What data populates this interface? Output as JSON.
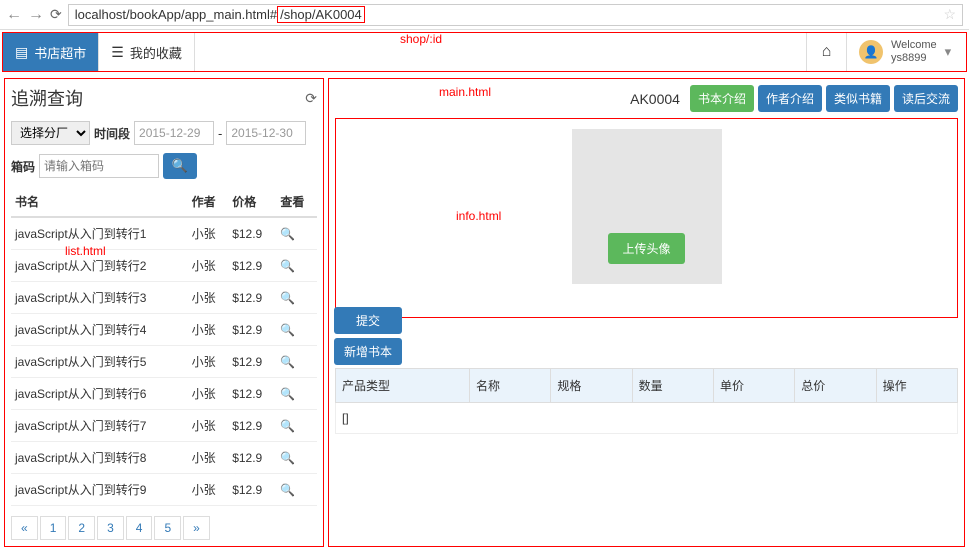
{
  "browser": {
    "url_prefix": "localhost/bookApp/app_main.html#",
    "url_hl": "/shop/AK0004"
  },
  "annotations": {
    "shop_id": "shop/:id",
    "main_html": "main.html",
    "list_html": "list.html",
    "info_html": "info.html"
  },
  "header": {
    "tab1": "书店超市",
    "tab2": "我的收藏",
    "welcome": "Welcome",
    "username": "ys8899"
  },
  "left": {
    "title": "追溯查询",
    "select_label": "选择分厂",
    "period_label": "时间段",
    "date1": "2015-12-29",
    "date2": "2015-12-30",
    "box_label": "箱码",
    "box_ph": "请输入箱码",
    "cols": {
      "name": "书名",
      "author": "作者",
      "price": "价格",
      "view": "查看"
    },
    "rows": [
      {
        "name": "javaScript从入门到转行1",
        "author": "小张",
        "price": "$12.9"
      },
      {
        "name": "javaScript从入门到转行2",
        "author": "小张",
        "price": "$12.9"
      },
      {
        "name": "javaScript从入门到转行3",
        "author": "小张",
        "price": "$12.9"
      },
      {
        "name": "javaScript从入门到转行4",
        "author": "小张",
        "price": "$12.9"
      },
      {
        "name": "javaScript从入门到转行5",
        "author": "小张",
        "price": "$12.9"
      },
      {
        "name": "javaScript从入门到转行6",
        "author": "小张",
        "price": "$12.9"
      },
      {
        "name": "javaScript从入门到转行7",
        "author": "小张",
        "price": "$12.9"
      },
      {
        "name": "javaScript从入门到转行8",
        "author": "小张",
        "price": "$12.9"
      },
      {
        "name": "javaScript从入门到转行9",
        "author": "小张",
        "price": "$12.9"
      }
    ],
    "pager": [
      "«",
      "1",
      "2",
      "3",
      "4",
      "5",
      "»"
    ]
  },
  "right": {
    "code": "AK0004",
    "tabs": {
      "t1": "书本介绍",
      "t2": "作者介绍",
      "t3": "类似书籍",
      "t4": "读后交流"
    },
    "upload": "上传头像",
    "submit": "提交",
    "addbook": "新增书本",
    "prod_cols": {
      "type": "产品类型",
      "name": "名称",
      "spec": "规格",
      "qty": "数量",
      "unit": "单价",
      "total": "总价",
      "op": "操作"
    },
    "empty": "[]"
  }
}
